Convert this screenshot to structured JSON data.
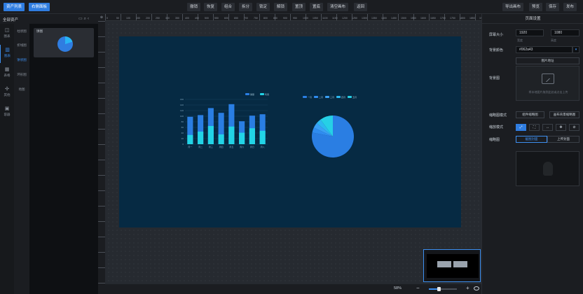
{
  "topbar": {
    "left_buttons": [
      "资产列表",
      "右侧面板"
    ],
    "center_buttons": [
      "撤销",
      "恢复",
      "组合",
      "拆分",
      "锁定",
      "解锁",
      "置顶",
      "置底",
      "清空画布",
      "返回"
    ],
    "right_buttons": [
      "导出画布",
      "预览",
      "保存",
      "发布"
    ]
  },
  "left_panel": {
    "title": "全部资产",
    "tool_icons": [
      "folder-icon",
      "search-icon",
      "collapse-icon"
    ],
    "categories": [
      {
        "label": "图表",
        "icon": "chart-icon",
        "active": false
      },
      {
        "label": "图表",
        "icon": "bar-chart-icon",
        "active": true
      },
      {
        "label": "表格",
        "icon": "table-icon",
        "active": false
      },
      {
        "label": "其他",
        "icon": "widget-icon",
        "active": false
      },
      {
        "label": "容器",
        "icon": "container-icon",
        "active": false
      }
    ],
    "subcategories": [
      {
        "label": "柱状图",
        "active": false
      },
      {
        "label": "折线图",
        "active": false
      },
      {
        "label": "饼状图",
        "active": true
      },
      {
        "label": "环形图",
        "active": false
      },
      {
        "label": "地图",
        "active": false
      }
    ],
    "thumbnail_label": "饼图"
  },
  "canvas": {
    "zoom": "58%",
    "zoom_fraction": 0.35,
    "ruler_labels": [
      "0",
      "50",
      "100",
      "150",
      "200",
      "250",
      "300",
      "350",
      "400",
      "450",
      "500",
      "550",
      "600",
      "650",
      "700",
      "750",
      "800",
      "850",
      "900",
      "950",
      "1000",
      "1050",
      "1100",
      "1150",
      "1200",
      "1250",
      "1300",
      "1350",
      "1400",
      "1450",
      "1500",
      "1550",
      "1600",
      "1650",
      "1700",
      "1750",
      "1800",
      "1850",
      "1900"
    ]
  },
  "chart_data": [
    {
      "type": "bar",
      "categories": [
        "周一",
        "周二",
        "周三",
        "周四",
        "周五",
        "周六",
        "周日",
        "周八"
      ],
      "series": [
        {
          "name": "销量",
          "values": [
            98,
            104,
            129,
            112,
            143,
            82,
            102,
            107
          ]
        },
        {
          "name": "利润",
          "values": [
            33,
            45,
            65,
            35,
            63,
            41,
            57,
            48
          ]
        }
      ],
      "ylim": [
        0,
        160
      ],
      "yticks": [
        "0",
        "20",
        "40",
        "60",
        "80",
        "100",
        "120",
        "140",
        "160"
      ],
      "colors": [
        "#2a7ee3",
        "#22d4e6"
      ],
      "legend_position": "top"
    },
    {
      "type": "pie",
      "labels": [
        "一月",
        "二月",
        "三月",
        "四月",
        "五月"
      ],
      "values": [
        78,
        4,
        4,
        4,
        10
      ],
      "colors": [
        "#2a7ee3",
        "#2f8cf0",
        "#3aa0f5",
        "#2bb8f0",
        "#26d0e6"
      ],
      "legend_position": "top"
    }
  ],
  "right_panel": {
    "header": "页面设置",
    "screen_size_label": "屏幕大小",
    "width_value": "1920",
    "height_value": "1080",
    "width_hint": "宽度",
    "height_hint": "高度",
    "bg_color_label": "背景颜色",
    "bg_color_value": "#062a43",
    "bg_image_label": "背景图",
    "bg_image_btn": "图片地址",
    "upload_hint": "将本地图片拖到此处或点击上传",
    "thumb_mode_label": "缩略图模式",
    "thumb_mode_buttons": [
      "组件缩略图",
      "画布背景缩略图"
    ],
    "fit_mode_label": "缩放模式",
    "cover_label": "缩略图",
    "cover_buttons": [
      "截图封面",
      "上传封面"
    ]
  }
}
